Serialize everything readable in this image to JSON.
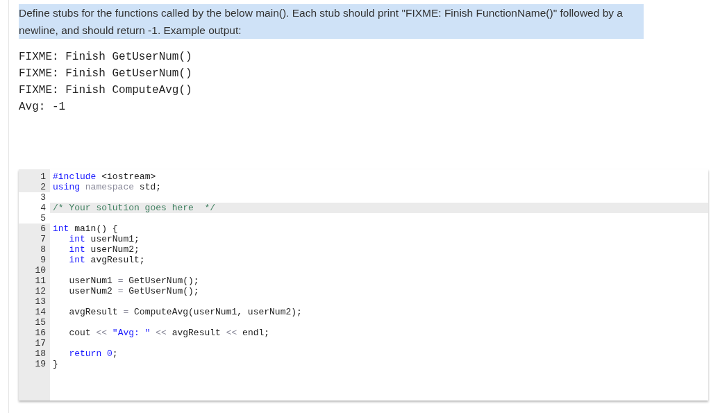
{
  "instructions": "Define stubs for the functions called by the below main(). Each stub should print \"FIXME: Finish FunctionName()\" followed by a newline, and should return -1. Example output:",
  "example_output": [
    "FIXME: Finish GetUserNum()",
    "FIXME: Finish GetUserNum()",
    "FIXME: Finish ComputeAvg()",
    "Avg: -1"
  ],
  "code_editor": {
    "lines": [
      {
        "number": "1",
        "editable": false,
        "active": false,
        "tokens": [
          {
            "kind": "keyword",
            "text": "#include"
          },
          {
            "kind": "plain",
            "text": " <iostream>"
          }
        ]
      },
      {
        "number": "2",
        "editable": false,
        "active": false,
        "tokens": [
          {
            "kind": "keyword",
            "text": "using"
          },
          {
            "kind": "operator",
            "text": " namespace"
          },
          {
            "kind": "plain",
            "text": " std;"
          }
        ]
      },
      {
        "number": "3",
        "editable": true,
        "active": false
      },
      {
        "number": "4",
        "editable": true,
        "active": true,
        "tokens": [
          {
            "kind": "comment",
            "text": "/* Your solution goes here  */"
          }
        ]
      },
      {
        "number": "5",
        "editable": true,
        "active": false
      },
      {
        "number": "6",
        "editable": false,
        "active": false,
        "tokens": [
          {
            "kind": "keyword",
            "text": "int"
          },
          {
            "kind": "plain",
            "text": " main() {"
          }
        ]
      },
      {
        "number": "7",
        "editable": false,
        "active": false,
        "tokens": [
          {
            "kind": "keyword",
            "text": "   int"
          },
          {
            "kind": "plain",
            "text": " userNum1;"
          }
        ]
      },
      {
        "number": "8",
        "editable": false,
        "active": false,
        "tokens": [
          {
            "kind": "keyword",
            "text": "   int"
          },
          {
            "kind": "plain",
            "text": " userNum2;"
          }
        ]
      },
      {
        "number": "9",
        "editable": false,
        "active": false,
        "tokens": [
          {
            "kind": "keyword",
            "text": "   int"
          },
          {
            "kind": "plain",
            "text": " avgResult;"
          }
        ]
      },
      {
        "number": "10",
        "editable": false,
        "active": false
      },
      {
        "number": "11",
        "editable": false,
        "active": false,
        "tokens": [
          {
            "kind": "plain",
            "text": "   userNum1 "
          },
          {
            "kind": "operator",
            "text": "="
          },
          {
            "kind": "plain",
            "text": " GetUserNum();"
          }
        ]
      },
      {
        "number": "12",
        "editable": false,
        "active": false,
        "tokens": [
          {
            "kind": "plain",
            "text": "   userNum2 "
          },
          {
            "kind": "operator",
            "text": "="
          },
          {
            "kind": "plain",
            "text": " GetUserNum();"
          }
        ]
      },
      {
        "number": "13",
        "editable": false,
        "active": false
      },
      {
        "number": "14",
        "editable": false,
        "active": false,
        "tokens": [
          {
            "kind": "plain",
            "text": "   avgResult "
          },
          {
            "kind": "operator",
            "text": "="
          },
          {
            "kind": "plain",
            "text": " ComputeAvg(userNum1, userNum2);"
          }
        ]
      },
      {
        "number": "15",
        "editable": false,
        "active": false
      },
      {
        "number": "16",
        "editable": false,
        "active": false,
        "tokens": [
          {
            "kind": "plain",
            "text": "   cout "
          },
          {
            "kind": "operator",
            "text": "<<"
          },
          {
            "kind": "string",
            "text": " \"Avg: \" "
          },
          {
            "kind": "operator",
            "text": "<<"
          },
          {
            "kind": "plain",
            "text": " avgResult "
          },
          {
            "kind": "operator",
            "text": "<<"
          },
          {
            "kind": "plain",
            "text": " endl;"
          }
        ]
      },
      {
        "number": "17",
        "editable": false,
        "active": false
      },
      {
        "number": "18",
        "editable": false,
        "active": false,
        "tokens": [
          {
            "kind": "keyword",
            "text": "   return"
          },
          {
            "kind": "number",
            "text": " 0"
          },
          {
            "kind": "plain",
            "text": ";"
          }
        ]
      },
      {
        "number": "19",
        "editable": false,
        "active": false,
        "tokens": [
          {
            "kind": "plain",
            "text": "}"
          }
        ]
      }
    ]
  }
}
